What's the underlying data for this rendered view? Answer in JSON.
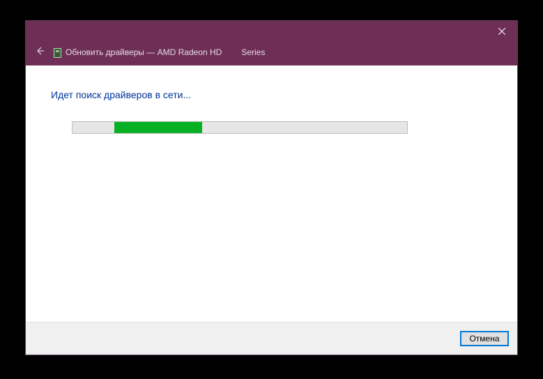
{
  "titlebar": {
    "title_prefix": "Обновить драйверы — AMD Radeon HD",
    "title_suffix": "Series"
  },
  "content": {
    "status_text": "Идет поиск драйверов в сети..."
  },
  "footer": {
    "cancel_label": "Отмена"
  }
}
